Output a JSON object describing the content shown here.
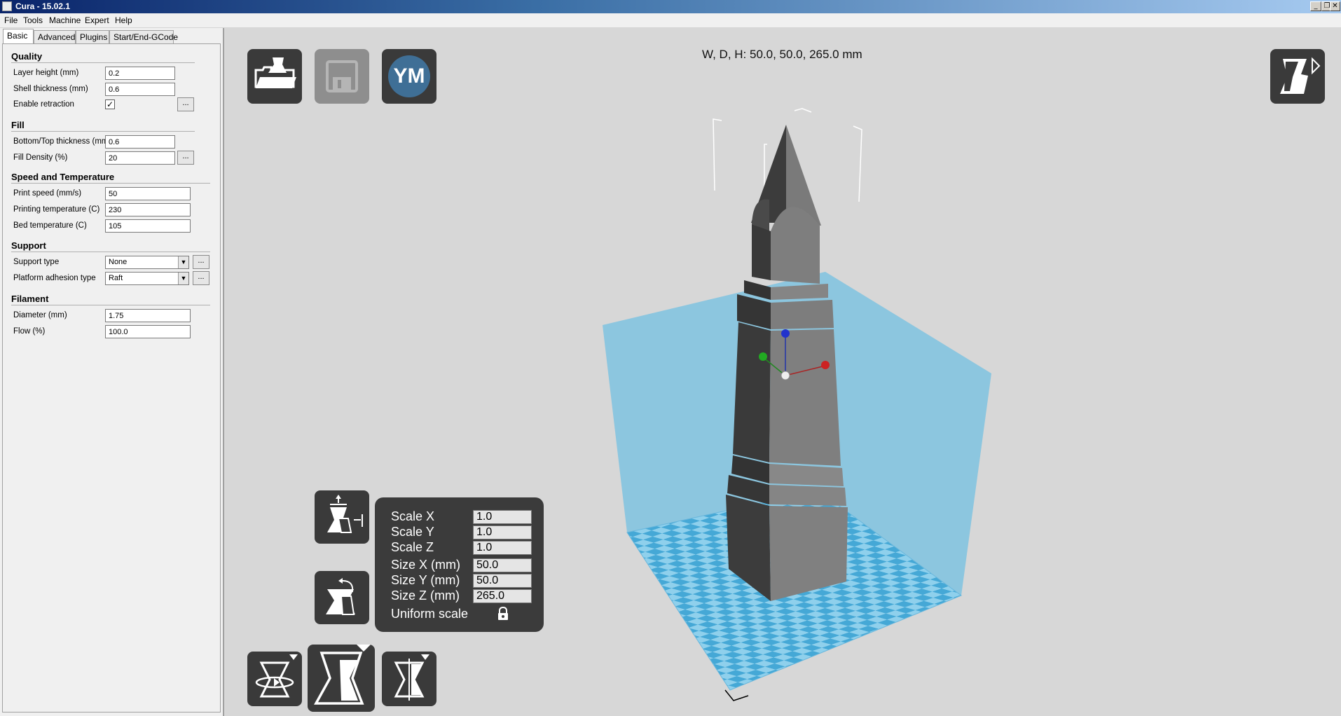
{
  "window": {
    "title": "Cura - 15.02.1",
    "controls": [
      "_",
      "❐",
      "✕"
    ]
  },
  "menu": [
    "File",
    "Tools",
    "Machine",
    "Expert",
    "Help"
  ],
  "tabs": [
    "Basic",
    "Advanced",
    "Plugins",
    "Start/End-GCode"
  ],
  "sections": {
    "quality": {
      "title": "Quality",
      "layer_height_label": "Layer height (mm)",
      "layer_height": "0.2",
      "shell_thickness_label": "Shell thickness (mm)",
      "shell_thickness": "0.6",
      "retraction_label": "Enable retraction",
      "retraction_checked": "✓"
    },
    "fill": {
      "title": "Fill",
      "bottom_top_label": "Bottom/Top thickness (mm)",
      "bottom_top": "0.6",
      "density_label": "Fill Density (%)",
      "density": "20"
    },
    "speed": {
      "title": "Speed and Temperature",
      "print_speed_label": "Print speed (mm/s)",
      "print_speed": "50",
      "print_temp_label": "Printing temperature (C)",
      "print_temp": "230",
      "bed_temp_label": "Bed temperature (C)",
      "bed_temp": "105"
    },
    "support": {
      "title": "Support",
      "type_label": "Support type",
      "type": "None",
      "adhesion_label": "Platform adhesion type",
      "adhesion": "Raft"
    },
    "filament": {
      "title": "Filament",
      "diameter_label": "Diameter (mm)",
      "diameter": "1.75",
      "flow_label": "Flow (%)",
      "flow": "100.0"
    }
  },
  "dots_label": "...",
  "viewport": {
    "dimensions": "W, D, H: 50.0, 50.0, 265.0 mm",
    "ym_label": "YM"
  },
  "scale_panel": {
    "rows": [
      {
        "label": "Scale X",
        "value": "1.0"
      },
      {
        "label": "Scale Y",
        "value": "1.0"
      },
      {
        "label": "Scale Z",
        "value": "1.0"
      },
      {
        "label": "Size X (mm)",
        "value": "50.0"
      },
      {
        "label": "Size Y (mm)",
        "value": "50.0"
      },
      {
        "label": "Size Z (mm)",
        "value": "265.0"
      }
    ],
    "uniform_label": "Uniform scale"
  },
  "colors": {
    "build_volume": "#7fc3e0",
    "plate_light": "#8fd0ec",
    "plate_dark": "#45a8d6",
    "model_light": "#7d7d7d",
    "model_dark": "#3c3c3c",
    "button_bg": "#3a3a3a"
  }
}
